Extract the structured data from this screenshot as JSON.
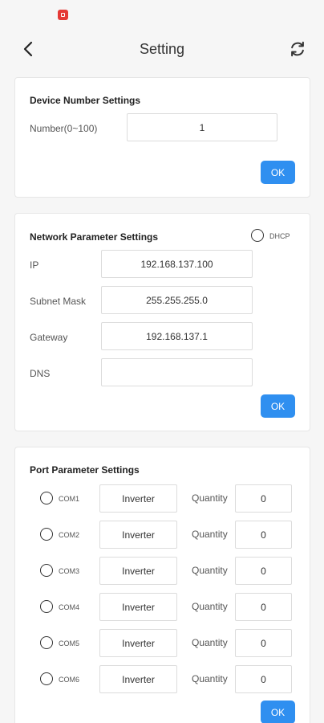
{
  "header": {
    "title": "Setting",
    "back_icon": "chevron-left-icon",
    "refresh_icon": "refresh-icon"
  },
  "device_number": {
    "title": "Device Number Settings",
    "label": "Number(0~100)",
    "value": "1",
    "ok_label": "OK"
  },
  "network": {
    "title": "Network Parameter Settings",
    "dhcp_label": "DHCP",
    "fields": [
      {
        "label": "IP",
        "value": "192.168.137.100"
      },
      {
        "label": "Subnet Mask",
        "value": "255.255.255.0"
      },
      {
        "label": "Gateway",
        "value": "192.168.137.1"
      },
      {
        "label": "DNS",
        "value": ""
      }
    ],
    "ok_label": "OK"
  },
  "ports": {
    "title": "Port Parameter Settings",
    "quantity_label": "Quantity",
    "rows": [
      {
        "name": "COM1",
        "type": "Inverter",
        "quantity": "0"
      },
      {
        "name": "COM2",
        "type": "Inverter",
        "quantity": "0"
      },
      {
        "name": "COM3",
        "type": "Inverter",
        "quantity": "0"
      },
      {
        "name": "COM4",
        "type": "Inverter",
        "quantity": "0"
      },
      {
        "name": "COM5",
        "type": "Inverter",
        "quantity": "0"
      },
      {
        "name": "COM6",
        "type": "Inverter",
        "quantity": "0"
      }
    ],
    "ok_label": "OK"
  },
  "colors": {
    "accent": "#2f8ff0",
    "status_icon": "#e53935",
    "background": "#f6f6f6"
  }
}
